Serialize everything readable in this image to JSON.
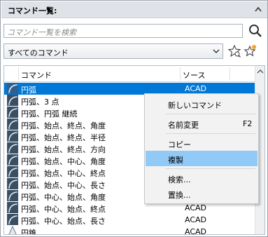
{
  "panel": {
    "title": "コマンド一覧:"
  },
  "search": {
    "placeholder": "コマンド一覧を検索"
  },
  "filter": {
    "selected": "すべてのコマンド"
  },
  "list": {
    "columns": [
      "コマンド",
      "ソース"
    ],
    "rows": [
      {
        "name": "円弧",
        "source": "ACAD",
        "selected": true
      },
      {
        "name": "円弧、3 点",
        "source": "ACAD"
      },
      {
        "name": "円弧、円弧 継続",
        "source": "ACAD"
      },
      {
        "name": "円弧、始点、終点、角度",
        "source": "ACAD"
      },
      {
        "name": "円弧、始点、終点、半径",
        "source": "ACAD"
      },
      {
        "name": "円弧、始点、終点、方向",
        "source": "ACAD"
      },
      {
        "name": "円弧、始点、中心、角度",
        "source": "ACAD"
      },
      {
        "name": "円弧、始点、中心、終点",
        "source": "ACAD"
      },
      {
        "name": "円弧、始点、中心、長さ",
        "source": "ACAD"
      },
      {
        "name": "円弧、中心、始点、角度",
        "source": "ACAD"
      },
      {
        "name": "円弧、中心、始点、終点",
        "source": "ACAD"
      },
      {
        "name": "円弧、中心、始点、長さ",
        "source": "ACAD"
      },
      {
        "name": "円錐",
        "source": "ACAD"
      }
    ]
  },
  "context_menu": {
    "items": [
      {
        "label": "新しいコマンド",
        "shortcut": ""
      },
      {
        "label": "名前変更",
        "shortcut": "F2"
      },
      {
        "label": "コピー",
        "shortcut": ""
      },
      {
        "label": "複製",
        "shortcut": "",
        "highlighted": true
      },
      {
        "label": "検索...",
        "shortcut": ""
      },
      {
        "label": "置換...",
        "shortcut": ""
      }
    ]
  },
  "colors": {
    "selection": "#0078d7",
    "menu_highlight": "#91c9f7",
    "title_bar": "#dfe3e8"
  }
}
